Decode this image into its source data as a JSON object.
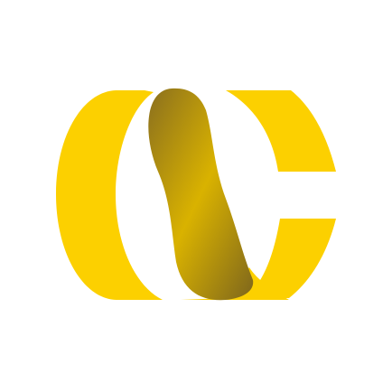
{
  "logo": {
    "icon": "interlocking-oc-ribbon-icon",
    "colors": {
      "primary": "#FCD000",
      "shade_light": "#D9B200",
      "shade_dark": "#8A6F1E",
      "background": "#FFFFFF"
    }
  }
}
